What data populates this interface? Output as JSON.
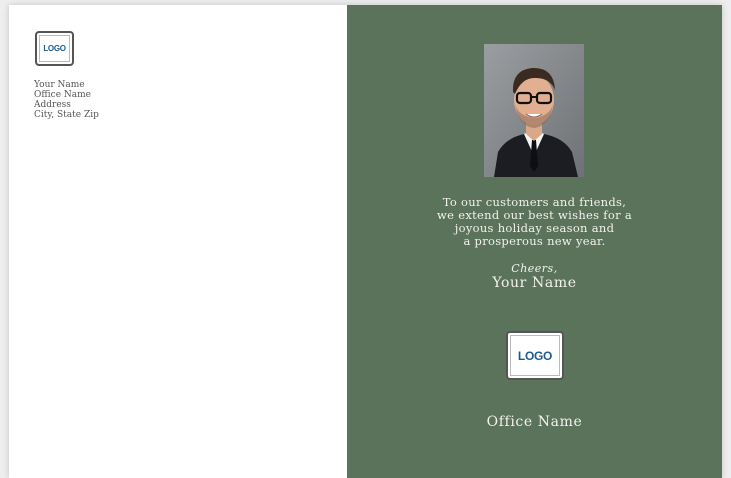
{
  "colors": {
    "panel_right": "#5b735b",
    "logo_text": "#1e5b8c"
  },
  "left_panel": {
    "logo": {
      "label": "LOGO"
    },
    "address_lines": [
      "Your Name",
      "Office Name",
      "Address",
      "City, State Zip"
    ]
  },
  "right_panel": {
    "photo": {
      "icon": "portrait-photo"
    },
    "greeting_lines": [
      "To our customers and friends,",
      "we extend our best wishes for a",
      "joyous holiday season and",
      "a prosperous new year."
    ],
    "cheers": "Cheers,",
    "signer_name": "Your Name",
    "logo": {
      "label": "LOGO"
    },
    "office_name": "Office Name"
  }
}
